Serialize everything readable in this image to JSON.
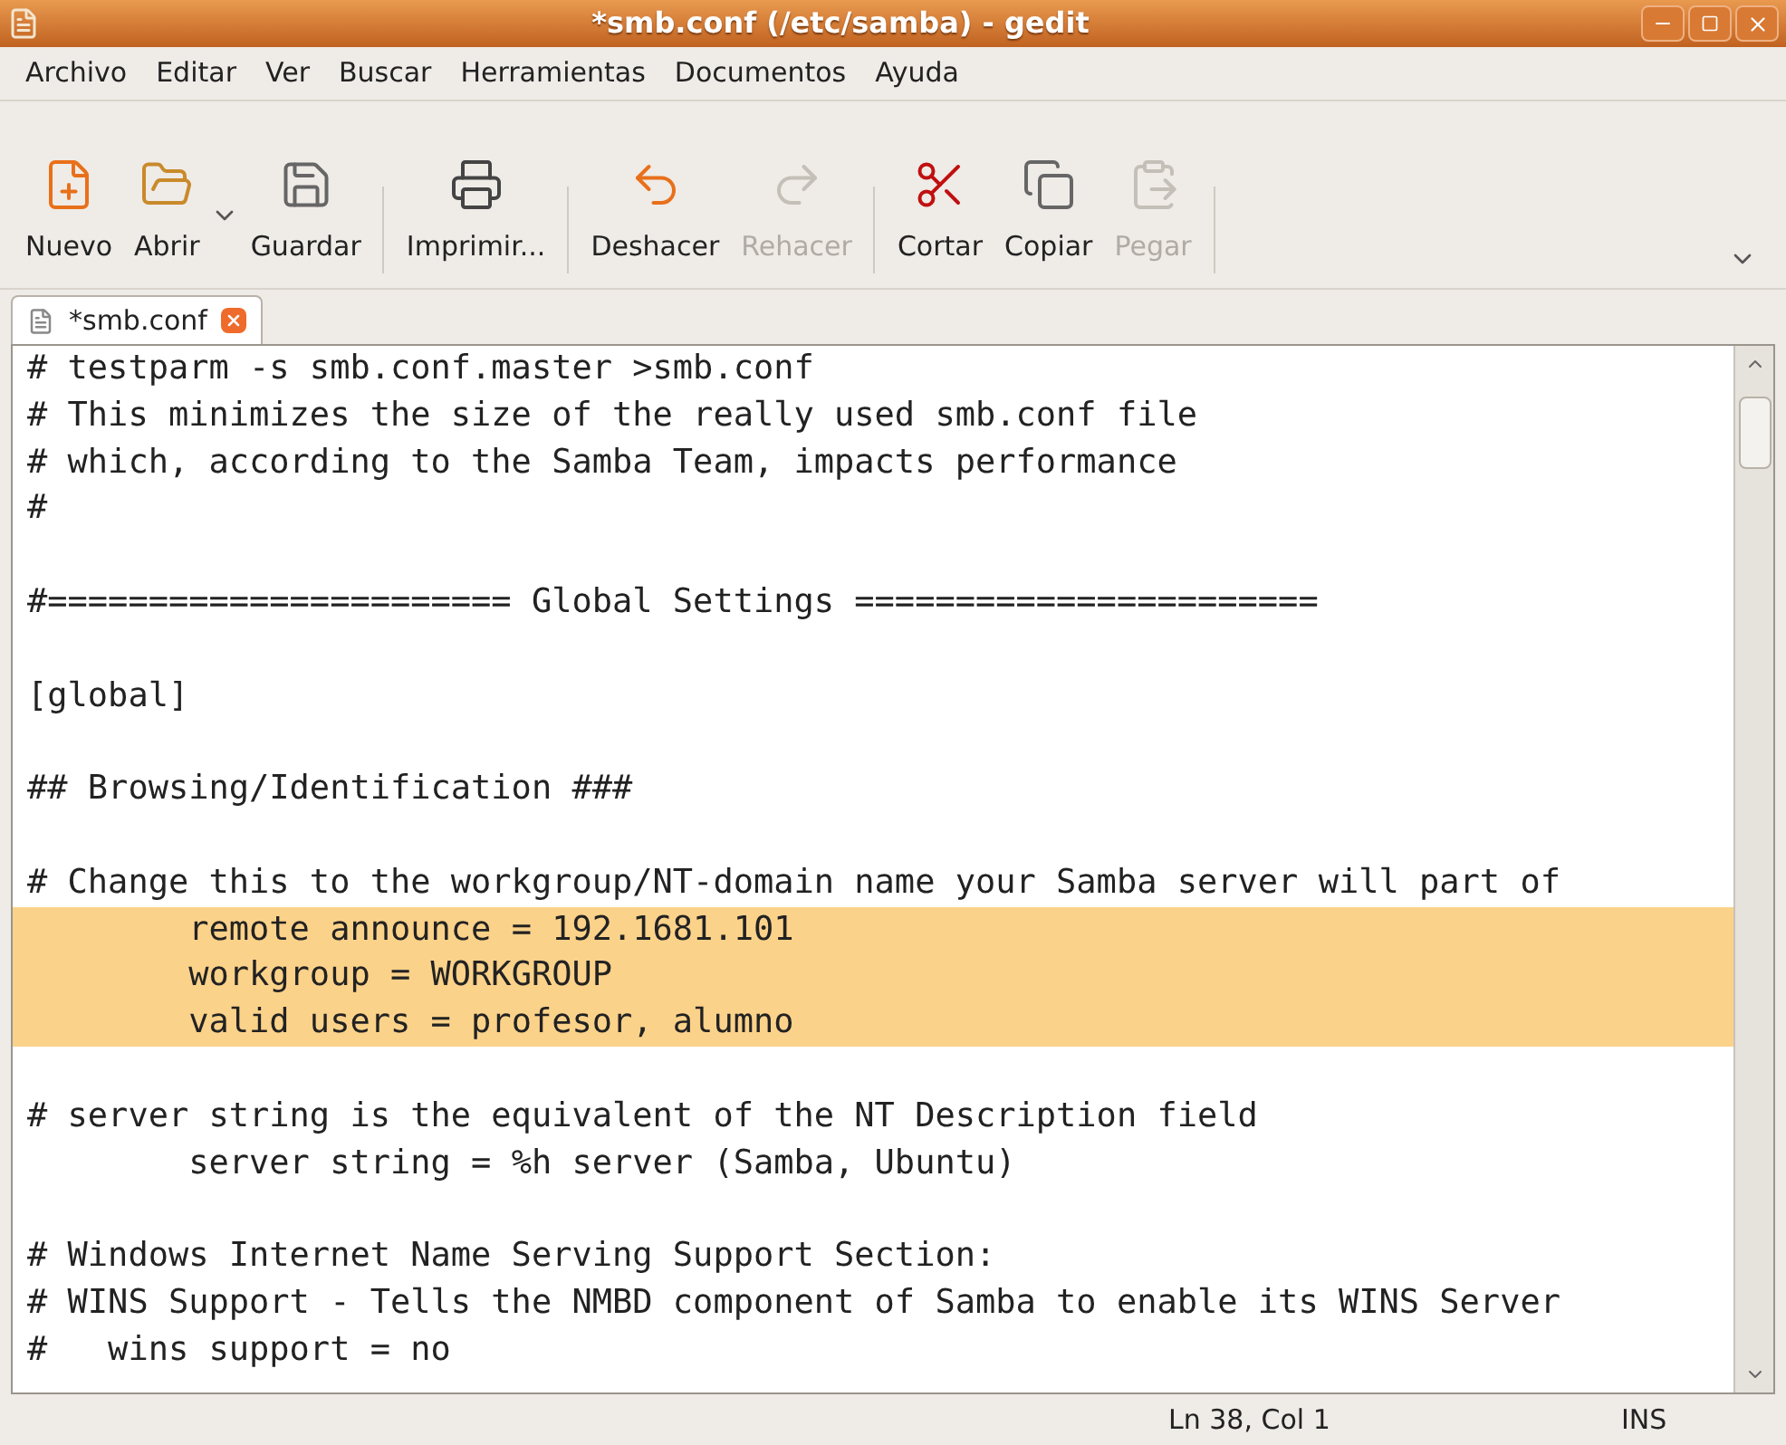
{
  "window": {
    "title": "*smb.conf (/etc/samba) - gedit"
  },
  "menu": [
    "Archivo",
    "Editar",
    "Ver",
    "Buscar",
    "Herramientas",
    "Documentos",
    "Ayuda"
  ],
  "toolbar": [
    {
      "kind": "button",
      "label": "Nuevo",
      "disabled": false
    },
    {
      "kind": "button",
      "label": "Abrir",
      "disabled": false
    },
    {
      "kind": "dropdown"
    },
    {
      "kind": "button",
      "label": "Guardar",
      "disabled": false
    },
    {
      "kind": "separator"
    },
    {
      "kind": "button",
      "label": "Imprimir...",
      "disabled": false
    },
    {
      "kind": "separator"
    },
    {
      "kind": "button",
      "label": "Deshacer",
      "disabled": false
    },
    {
      "kind": "button",
      "label": "Rehacer",
      "disabled": true
    },
    {
      "kind": "separator"
    },
    {
      "kind": "button",
      "label": "Cortar",
      "disabled": false
    },
    {
      "kind": "button",
      "label": "Copiar",
      "disabled": false
    },
    {
      "kind": "button",
      "label": "Pegar",
      "disabled": true
    },
    {
      "kind": "separator"
    },
    {
      "kind": "overflow"
    }
  ],
  "tabs": [
    {
      "label": "*smb.conf",
      "selected": true
    }
  ],
  "editor": {
    "lines": [
      {
        "text": "# testparm -s smb.conf.master >smb.conf",
        "highlighted": false
      },
      {
        "text": "# This minimizes the size of the really used smb.conf file",
        "highlighted": false
      },
      {
        "text": "# which, according to the Samba Team, impacts performance",
        "highlighted": false
      },
      {
        "text": "#",
        "highlighted": false
      },
      {
        "highlighted": false
      },
      {
        "text": "#======================= Global Settings =======================",
        "highlighted": false
      },
      {
        "highlighted": false
      },
      {
        "text": "[global]",
        "highlighted": false
      },
      {
        "highlighted": false
      },
      {
        "text": "## Browsing/Identification ###",
        "highlighted": false
      },
      {
        "highlighted": false
      },
      {
        "text": "# Change this to the workgroup/NT-domain name your Samba server will part of",
        "highlighted": false
      },
      {
        "text": "\tremote announce = 192.1681.101",
        "highlighted": true
      },
      {
        "text": "\tworkgroup = WORKGROUP",
        "highlighted": true
      },
      {
        "text": "\tvalid users = profesor, alumno",
        "highlighted": true
      },
      {
        "highlighted": false
      },
      {
        "text": "# server string is the equivalent of the NT Description field",
        "highlighted": false
      },
      {
        "text": "\tserver string = %h server (Samba, Ubuntu)",
        "highlighted": false
      },
      {
        "highlighted": false
      },
      {
        "text": "# Windows Internet Name Serving Support Section:",
        "highlighted": false
      },
      {
        "text": "# WINS Support - Tells the NMBD component of Samba to enable its WINS Server",
        "highlighted": false
      },
      {
        "text": "#   wins support = no",
        "highlighted": false
      }
    ]
  },
  "status_bar": {
    "position": "Ln 38, Col 1",
    "mode": "INS"
  }
}
